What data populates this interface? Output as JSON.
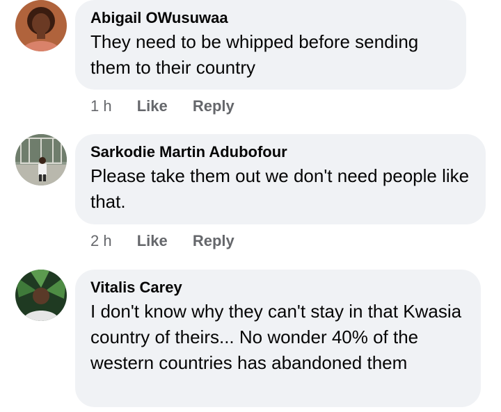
{
  "comments": [
    {
      "author": "Abigail OWusuwaa",
      "text": "They need to be whipped before sending them to their country",
      "time": "1 h",
      "like_label": "Like",
      "reply_label": "Reply"
    },
    {
      "author": "Sarkodie Martin Adubofour",
      "text": "Please take them out we don't need people like that.",
      "time": "2 h",
      "like_label": "Like",
      "reply_label": "Reply"
    },
    {
      "author": "Vitalis Carey",
      "text": "I don't know why they can't stay in that Kwasia country of theirs... No wonder 40% of the western countries has abandoned them"
    }
  ],
  "colors": {
    "bubble_bg": "#f0f2f5",
    "primary_text": "#050505",
    "secondary_text": "#65676b"
  }
}
